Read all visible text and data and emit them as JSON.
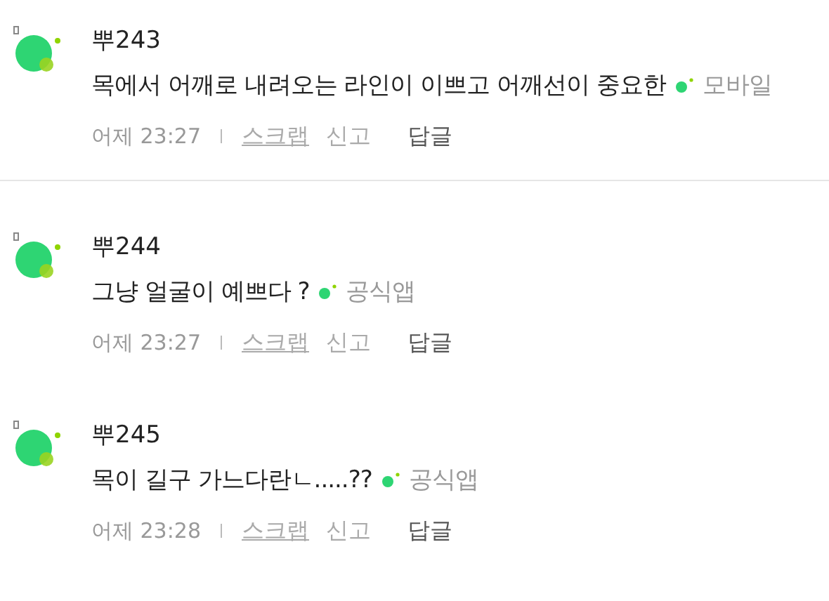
{
  "comments": [
    {
      "author": "뿌243",
      "text": "목에서 어깨로 내려오는 라인이 이쁘고 어깨선이 중요한",
      "source": "모바일",
      "time": "어제 23:27",
      "actions": [
        "스크랩",
        "신고",
        "답글"
      ],
      "separated": true
    },
    {
      "author": "뿌244",
      "text": "그냥 얼굴이 예쁘다 ?",
      "source": "공식앱",
      "time": "어제 23:27",
      "actions": [
        "스크랩",
        "신고",
        "답글"
      ],
      "separated": false
    },
    {
      "author": "뿌245",
      "text": "목이 길구 가느다란ㄴ.....??",
      "source": "공식앱",
      "time": "어제 23:28",
      "actions": [
        "스크랩",
        "신고",
        "답글"
      ],
      "separated": false
    }
  ]
}
